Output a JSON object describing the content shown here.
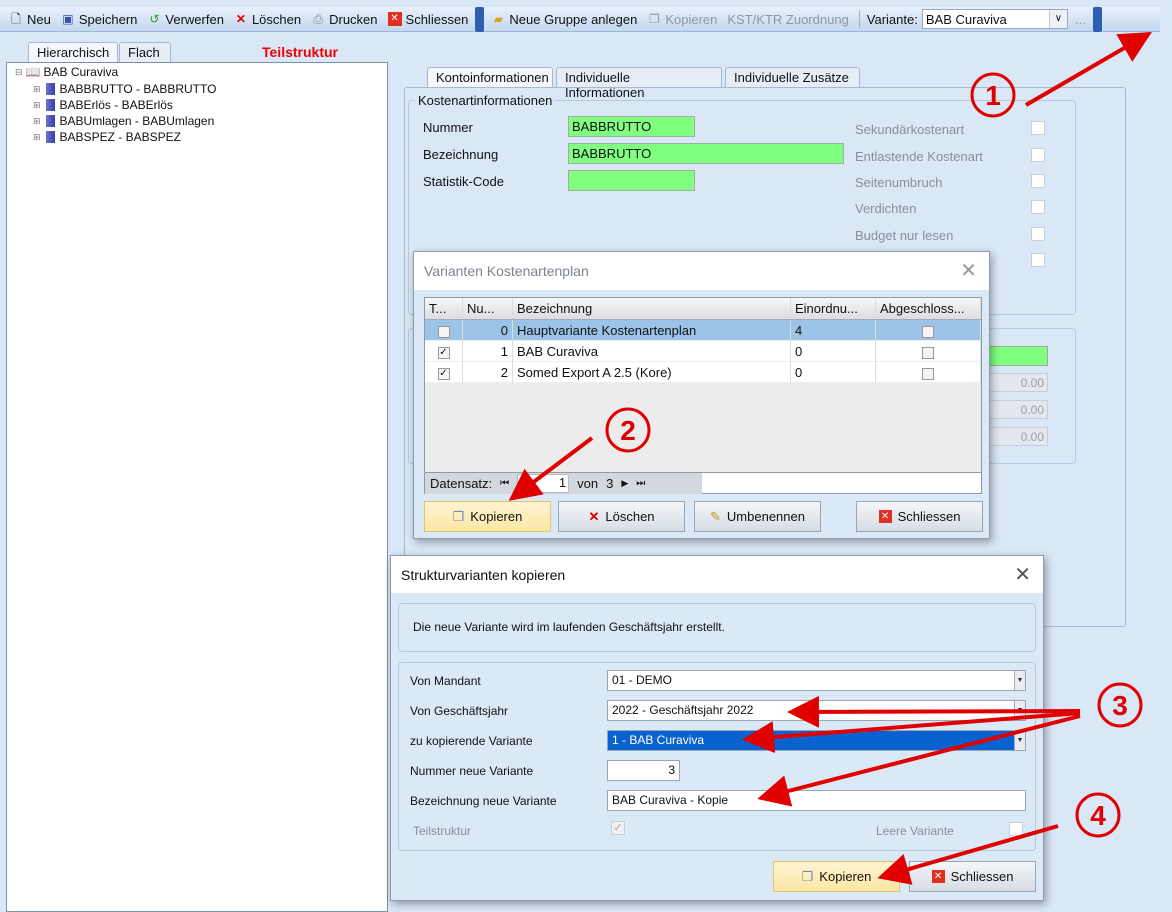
{
  "toolbar": {
    "new": "Neu",
    "save": "Speichern",
    "discard": "Verwerfen",
    "delete": "Löschen",
    "print": "Drucken",
    "close": "Schliessen",
    "new_group": "Neue Gruppe anlegen",
    "copy": "Kopieren",
    "kst_ktr": "KST/KTR Zuordnung",
    "variant_label": "Variante:",
    "variant_value": "BAB Curaviva",
    "more": "..."
  },
  "left": {
    "tabs": [
      "Hierarchisch",
      "Flach"
    ],
    "subtitle": "Teilstruktur",
    "tree_root": "BAB Curaviva",
    "tree_items": [
      "BABBRUTTO - BABBRUTTO",
      "BABErlös - BABErlös",
      "BABUmlagen - BABUmlagen",
      "BABSPEZ - BABSPEZ"
    ]
  },
  "right": {
    "tabs": [
      "Kontoinformationen",
      "Individuelle Informationen",
      "Individuelle Zusätze"
    ],
    "group_title": "Kostenartinformationen",
    "fields": [
      {
        "label": "Nummer",
        "value": "BABBRUTTO"
      },
      {
        "label": "Bezeichnung",
        "value": "BABBRUTTO"
      },
      {
        "label": "Statistik-Code",
        "value": ""
      }
    ],
    "checkboxes": [
      "Sekundärkostenart",
      "Entlastende Kostenart",
      "Seitenumbruch",
      "Verdichten",
      "Budget nur lesen"
    ],
    "amounts": [
      "0.00",
      "0.00",
      "0.00"
    ]
  },
  "variants_dialog": {
    "title": "Varianten Kostenartenplan",
    "columns": [
      "T...",
      "Nu...",
      "Bezeichnung",
      "Einordnu...",
      "Abgeschloss..."
    ],
    "rows": [
      {
        "t": false,
        "nr": "0",
        "name": "Hauptvariante Kostenartenplan",
        "einordnung": "4",
        "closed": false
      },
      {
        "t": true,
        "nr": "1",
        "name": "BAB Curaviva",
        "einordnung": "0",
        "closed": false
      },
      {
        "t": true,
        "nr": "2",
        "name": "Somed Export A 2.5 (Kore)",
        "einordnung": "0",
        "closed": false
      }
    ],
    "nav": {
      "label": "Datensatz:",
      "current": "1",
      "of": "von",
      "total": "3"
    },
    "buttons": {
      "copy": "Kopieren",
      "delete": "Löschen",
      "rename": "Umbenennen",
      "close": "Schliessen"
    }
  },
  "copy_dialog": {
    "title": "Strukturvarianten kopieren",
    "info": "Die neue Variante wird im laufenden Geschäftsjahr erstellt.",
    "fields": {
      "mandant_label": "Von Mandant",
      "mandant": "01 - DEMO",
      "year_label": "Von Geschäftsjahr",
      "year": "2022 - Geschäftsjahr 2022",
      "variant_label": "zu kopierende Variante",
      "variant": "1 - BAB Curaviva",
      "number_label": "Nummer neue Variante",
      "number": "3",
      "name_label": "Bezeichnung neue Variante",
      "name": "BAB Curaviva - Kopie",
      "partial_label": "Teilstruktur",
      "empty_label": "Leere Variante"
    },
    "buttons": {
      "copy": "Kopieren",
      "close": "Schliessen"
    }
  },
  "annotations": [
    "1",
    "2",
    "3",
    "4"
  ],
  "colors": {
    "accent": "#e00000",
    "selection": "#0a62d0",
    "green_field": "#80ff80"
  }
}
